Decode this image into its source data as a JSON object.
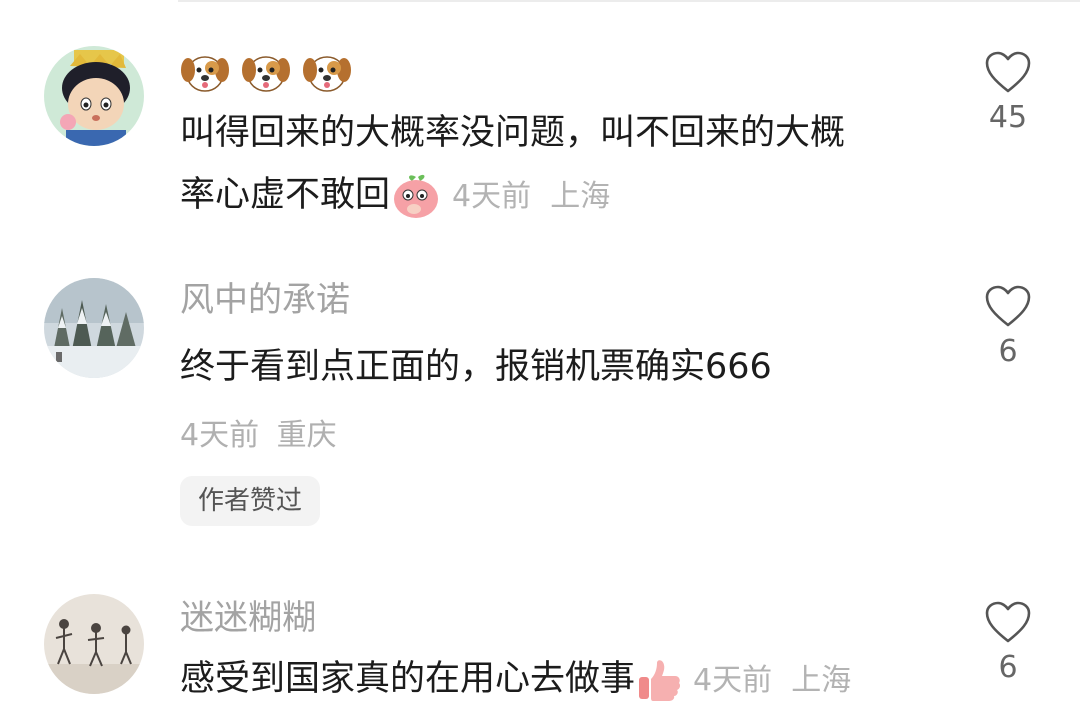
{
  "comments": [
    {
      "username_emoji": "dog-face-emoji x3",
      "text_line1": "叫得回来的大概率没问题，叫不回来的大概",
      "text_line2": "率心虚不敢回",
      "inline_emoji": "peach-face-emoji",
      "time": "4天前",
      "location": "上海",
      "likes": "45",
      "avatar": "cartoon-boy-avatar"
    },
    {
      "username": "风中的承诺",
      "text": "终于看到点正面的，报销机票确实666",
      "time": "4天前",
      "location": "重庆",
      "badge": "作者赞过",
      "likes": "6",
      "avatar": "snowy-forest-avatar"
    },
    {
      "username": "迷迷糊糊",
      "text": "感受到国家真的在用心去做事",
      "inline_emoji": "thumbs-up-emoji",
      "time": "4天前",
      "location": "上海",
      "likes": "6",
      "avatar": "figurines-avatar"
    }
  ],
  "colors": {
    "text": "#1c1c1c",
    "username": "#a3a3a3",
    "meta": "#b0b0b0",
    "badge_bg": "#f3f3f3",
    "heart": "#555555"
  },
  "icons": [
    "heart-outline-icon",
    "dog-face-emoji",
    "peach-face-emoji",
    "thumbs-up-emoji"
  ]
}
